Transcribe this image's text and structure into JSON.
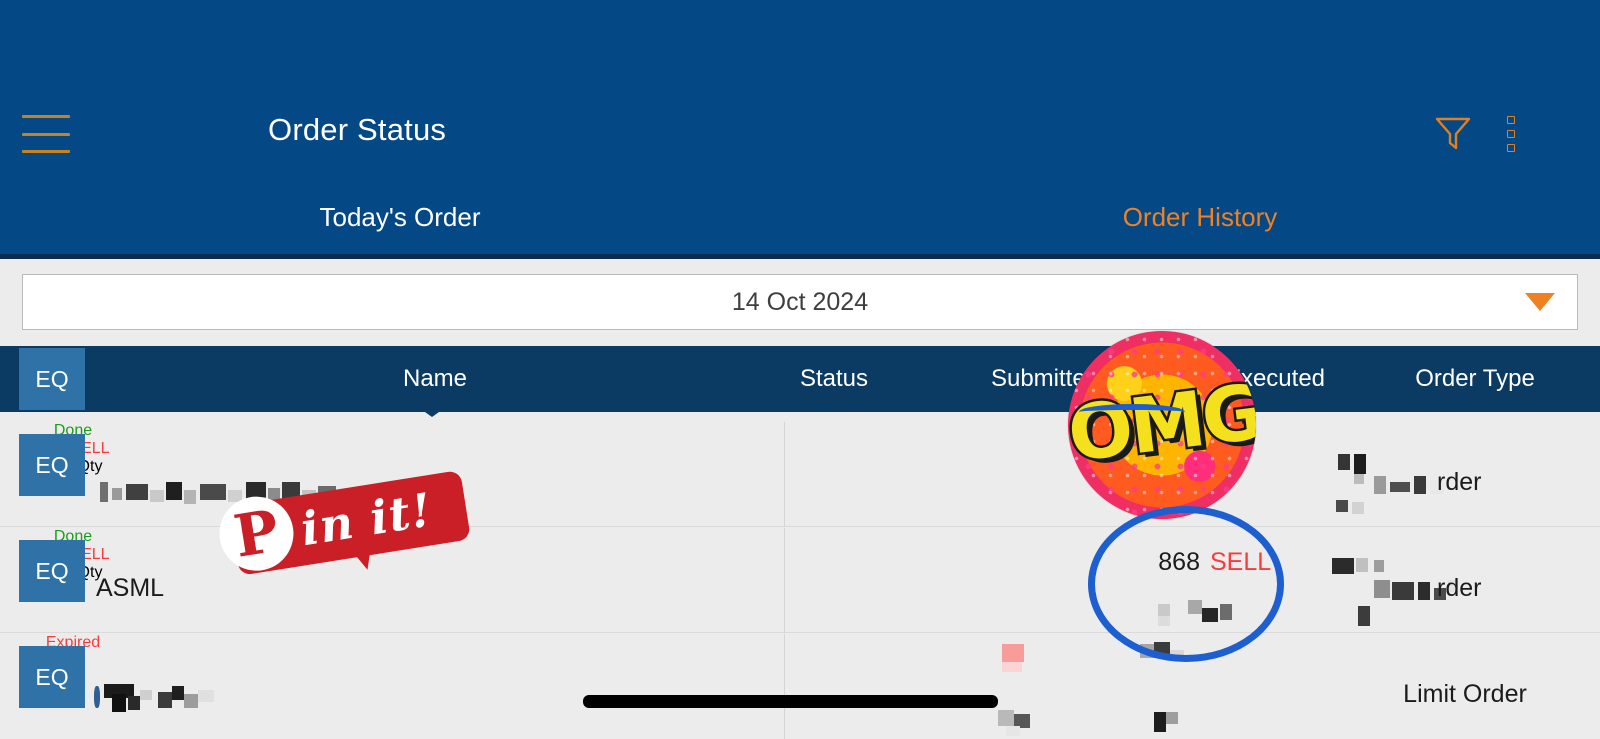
{
  "appbar": {
    "title": "Order Status",
    "menu_icon": "hamburger-icon",
    "filter_icon": "filter-funnel-icon",
    "overflow_icon": "kebab-menu-icon"
  },
  "tabs": [
    {
      "label": "Today's Order",
      "active": false
    },
    {
      "label": "Order History",
      "active": true
    }
  ],
  "date_selector": {
    "value": "14 Oct 2024",
    "caret_icon": "chevron-down-icon"
  },
  "table": {
    "badge_label": "EQ",
    "columns": [
      "Name",
      "Status",
      "Submitted",
      "Executed",
      "Order Type"
    ],
    "rows": [
      {
        "badge": "EQ",
        "name": "",
        "name_redacted": true,
        "status": "Done",
        "status_color": "#1a9e1a",
        "submitted_side": "SELL",
        "submitted_label": "Qty",
        "executed_qty": "",
        "executed_side": "",
        "order_type": "rder",
        "order_type_redacted": true
      },
      {
        "badge": "EQ",
        "name": "ASML",
        "name_redacted": false,
        "status": "Done",
        "status_color": "#1a9e1a",
        "submitted_side": "SELL",
        "submitted_label": "Qty",
        "executed_qty": "868",
        "executed_side": "SELL",
        "order_type": "rder",
        "order_type_redacted": true
      },
      {
        "badge": "EQ",
        "name": "",
        "name_redacted": true,
        "status": "Expired",
        "status_color": "#fa3b3b",
        "submitted_side": "",
        "submitted_label": "",
        "executed_qty": "",
        "executed_side": "",
        "order_type": "Limit Order",
        "order_type_redacted": false
      }
    ]
  },
  "overlays": {
    "omg_sticker": "OMG",
    "pinit_logo_glyph": "P",
    "pinit_text": "in it!",
    "blue_circle_annotation": "circle-annotation",
    "black_redaction_bar": "redaction-bar"
  },
  "colors": {
    "header_blue": "#044886",
    "table_header_navy": "#0b3a63",
    "badge_blue": "#2e72a8",
    "accent_orange": "#f08122",
    "status_done_green": "#1a9e1a",
    "status_expired_red": "#fa3b3b",
    "sell_red": "#fa3b3b",
    "page_background": "#ececec"
  }
}
